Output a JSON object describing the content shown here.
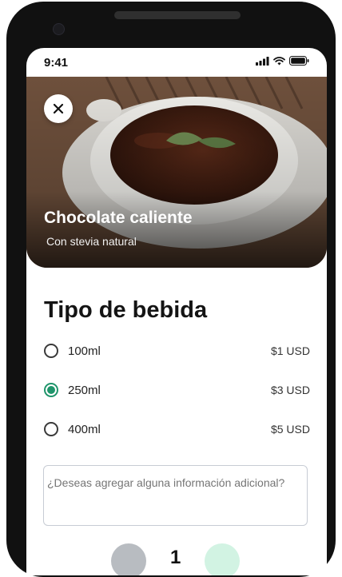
{
  "status_bar": {
    "time": "9:41"
  },
  "product": {
    "title": "Chocolate caliente",
    "subtitle": "Con stevia natural"
  },
  "section": {
    "title": "Tipo de bebida"
  },
  "options": [
    {
      "label": "100ml",
      "price": "$1 USD",
      "selected": false
    },
    {
      "label": "250ml",
      "price": "$3 USD",
      "selected": true
    },
    {
      "label": "400ml",
      "price": "$5 USD",
      "selected": false
    }
  ],
  "notes": {
    "placeholder": "¿Deseas agregar alguna información adicional?"
  },
  "quantity": {
    "value": "1"
  },
  "colors": {
    "accent": "#20956b",
    "plus_bg": "#d2f3e3",
    "minus_bg": "#b8bcc1"
  }
}
